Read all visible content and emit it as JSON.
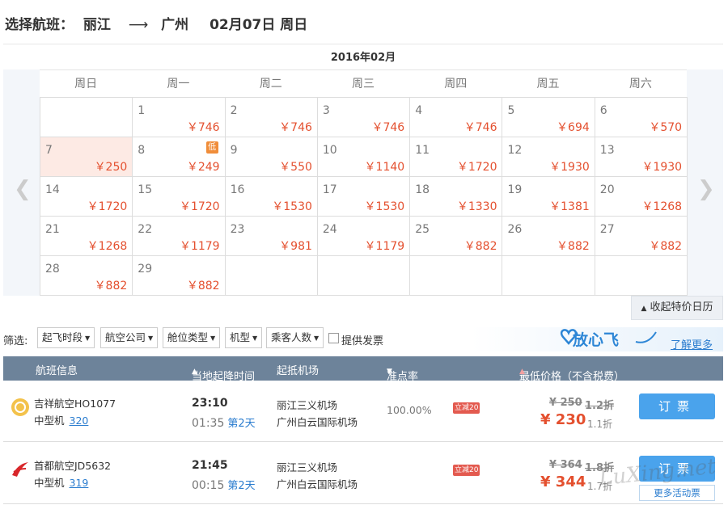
{
  "header": {
    "label": "选择航班：",
    "from": "丽江",
    "arrow": "⟶",
    "to": "广州",
    "date": "02月07日 周日"
  },
  "calendar": {
    "month": "2016年02月",
    "weekdays": [
      "周日",
      "周一",
      "周二",
      "周三",
      "周四",
      "周五",
      "周六"
    ],
    "days": [
      {
        "d": "",
        "p": ""
      },
      {
        "d": "1",
        "p": "￥746"
      },
      {
        "d": "2",
        "p": "￥746"
      },
      {
        "d": "3",
        "p": "￥746"
      },
      {
        "d": "4",
        "p": "￥746"
      },
      {
        "d": "5",
        "p": "￥694"
      },
      {
        "d": "6",
        "p": "￥570"
      },
      {
        "d": "7",
        "p": "￥250",
        "selected": true
      },
      {
        "d": "8",
        "p": "￥249",
        "low": "低"
      },
      {
        "d": "9",
        "p": "￥550"
      },
      {
        "d": "10",
        "p": "￥1140"
      },
      {
        "d": "11",
        "p": "￥1720"
      },
      {
        "d": "12",
        "p": "￥1930"
      },
      {
        "d": "13",
        "p": "￥1930"
      },
      {
        "d": "14",
        "p": "￥1720"
      },
      {
        "d": "15",
        "p": "￥1720"
      },
      {
        "d": "16",
        "p": "￥1530"
      },
      {
        "d": "17",
        "p": "￥1530"
      },
      {
        "d": "18",
        "p": "￥1330"
      },
      {
        "d": "19",
        "p": "￥1381"
      },
      {
        "d": "20",
        "p": "￥1268"
      },
      {
        "d": "21",
        "p": "￥1268"
      },
      {
        "d": "22",
        "p": "￥1179"
      },
      {
        "d": "23",
        "p": "￥981"
      },
      {
        "d": "24",
        "p": "￥1179"
      },
      {
        "d": "25",
        "p": "￥882"
      },
      {
        "d": "26",
        "p": "￥882"
      },
      {
        "d": "27",
        "p": "￥882"
      },
      {
        "d": "28",
        "p": "￥882"
      },
      {
        "d": "29",
        "p": "￥882"
      },
      {
        "d": "",
        "p": ""
      },
      {
        "d": "",
        "p": ""
      },
      {
        "d": "",
        "p": ""
      },
      {
        "d": "",
        "p": ""
      },
      {
        "d": "",
        "p": ""
      }
    ],
    "prev_icon": "chevron-left-icon",
    "next_icon": "chevron-right-icon",
    "collapse_label": "收起特价日历"
  },
  "filters": {
    "label": "筛选:",
    "items": [
      "起飞时段",
      "航空公司",
      "舱位类型",
      "机型",
      "乘客人数"
    ],
    "invoice_label": "提供发票",
    "brand": "放心飞",
    "more_label": "了解更多"
  },
  "table": {
    "headers": [
      "航班信息",
      "当地起降时间",
      "起抵机场",
      "准点率",
      "最低价格（不含税费）"
    ],
    "rows": [
      {
        "airline": "吉祥航空HO1077",
        "type": "中型机",
        "model": "320",
        "dep": "23:10",
        "arr": "01:35",
        "next": "第2天",
        "ap1": "丽江三义机场",
        "ap2": "广州白云国际机场",
        "rate": "100.00%",
        "badge": "立减20",
        "orig": "¥ 250",
        "orig_disc": "1.2折",
        "price": "¥ 230",
        "disc": "1.1折",
        "book": "订票",
        "promo": ""
      },
      {
        "airline": "首都航空JD5632",
        "type": "中型机",
        "model": "319",
        "dep": "21:45",
        "arr": "00:15",
        "next": "第2天",
        "ap1": "丽江三义机场",
        "ap2": "广州白云国际机场",
        "rate": "",
        "badge": "立减20",
        "orig": "¥ 364",
        "orig_disc": "1.8折",
        "price": "¥ 344",
        "disc": "1.7折",
        "book": "订票",
        "promo": "更多活动票"
      }
    ]
  },
  "watermark": "LuXing.net"
}
